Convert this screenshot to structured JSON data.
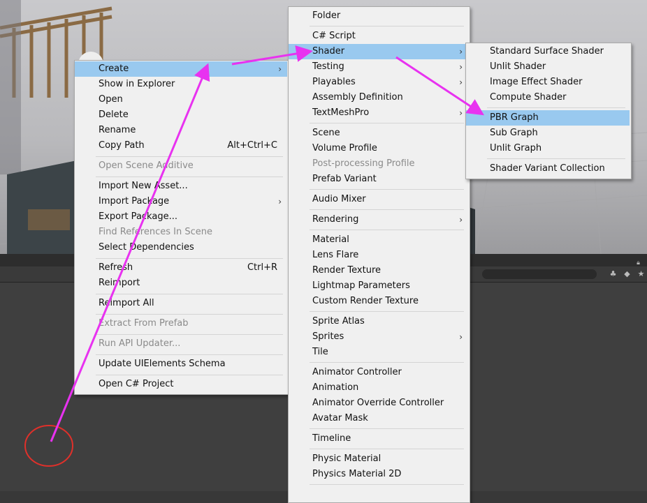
{
  "colors": {
    "menu_bg": "#f0f0f0",
    "highlight": "#99c9ef",
    "disabled_text": "#8a8a8a",
    "annotation_arrow": "#e832f0",
    "annotation_circle": "#e0302a",
    "editor_dark": "#3f3f3f"
  },
  "toolbar": {
    "icons": [
      "lock-icon",
      "filter-icon",
      "tag-icon",
      "star-icon"
    ]
  },
  "menu1": {
    "items": [
      {
        "label": "Create",
        "arrow": "›"
      },
      {
        "label": "Show in Explorer"
      },
      {
        "label": "Open"
      },
      {
        "label": "Delete"
      },
      {
        "label": "Rename"
      },
      {
        "label": "Copy Path",
        "shortcut": "Alt+Ctrl+C"
      },
      {
        "label": "Open Scene Additive"
      },
      {
        "label": "Import New Asset..."
      },
      {
        "label": "Import Package",
        "arrow": "›"
      },
      {
        "label": "Export Package..."
      },
      {
        "label": "Find References In Scene"
      },
      {
        "label": "Select Dependencies"
      },
      {
        "label": "Refresh",
        "shortcut": "Ctrl+R"
      },
      {
        "label": "Reimport"
      },
      {
        "label": "Reimport All"
      },
      {
        "label": "Extract From Prefab"
      },
      {
        "label": "Run API Updater..."
      },
      {
        "label": "Update UIElements Schema"
      },
      {
        "label": "Open C# Project"
      }
    ]
  },
  "menu2": {
    "items": [
      {
        "label": "Folder"
      },
      {
        "label": "C# Script"
      },
      {
        "label": "Shader",
        "arrow": "›"
      },
      {
        "label": "Testing",
        "arrow": "›"
      },
      {
        "label": "Playables",
        "arrow": "›"
      },
      {
        "label": "Assembly Definition"
      },
      {
        "label": "TextMeshPro",
        "arrow": "›"
      },
      {
        "label": "Scene"
      },
      {
        "label": "Volume Profile"
      },
      {
        "label": "Post-processing Profile"
      },
      {
        "label": "Prefab Variant"
      },
      {
        "label": "Audio Mixer"
      },
      {
        "label": "Rendering",
        "arrow": "›"
      },
      {
        "label": "Material"
      },
      {
        "label": "Lens Flare"
      },
      {
        "label": "Render Texture"
      },
      {
        "label": "Lightmap Parameters"
      },
      {
        "label": "Custom Render Texture"
      },
      {
        "label": "Sprite Atlas"
      },
      {
        "label": "Sprites",
        "arrow": "›"
      },
      {
        "label": "Tile"
      },
      {
        "label": "Animator Controller"
      },
      {
        "label": "Animation"
      },
      {
        "label": "Animator Override Controller"
      },
      {
        "label": "Avatar Mask"
      },
      {
        "label": "Timeline"
      },
      {
        "label": "Physic Material"
      },
      {
        "label": "Physics Material 2D"
      }
    ]
  },
  "menu3": {
    "items": [
      {
        "label": "Standard Surface Shader"
      },
      {
        "label": "Unlit Shader"
      },
      {
        "label": "Image Effect Shader"
      },
      {
        "label": "Compute Shader"
      },
      {
        "label": "PBR Graph"
      },
      {
        "label": "Sub Graph"
      },
      {
        "label": "Unlit Graph"
      },
      {
        "label": "Shader Variant Collection"
      }
    ]
  }
}
